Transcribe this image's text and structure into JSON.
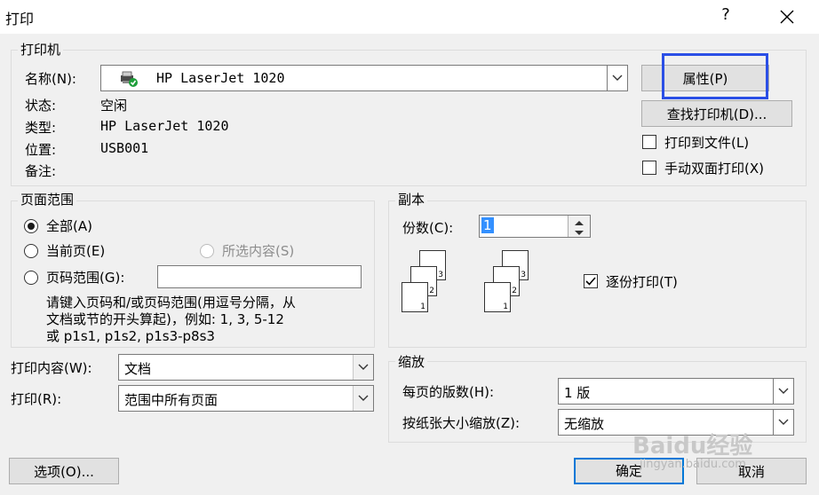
{
  "window": {
    "title": "打印",
    "help": "?"
  },
  "printer": {
    "group_label": "打印机",
    "name_label": "名称(N):",
    "name_value": "HP LaserJet 1020",
    "status_label": "状态:",
    "status_value": "空闲",
    "type_label": "类型:",
    "type_value": "HP LaserJet 1020",
    "where_label": "位置:",
    "where_value": "USB001",
    "comment_label": "备注:",
    "properties_button": "属性(P)",
    "find_button": "查找打印机(D)...",
    "print_to_file_label": "打印到文件(L)",
    "print_to_file_checked": false,
    "manual_duplex_label": "手动双面打印(X)",
    "manual_duplex_checked": false
  },
  "page_range": {
    "group_label": "页面范围",
    "all_label": "全部(A)",
    "current_label": "当前页(E)",
    "selection_label": "所选内容(S)",
    "pages_label": "页码范围(G):",
    "pages_value": "",
    "selected": "all",
    "hint_line1": "请键入页码和/或页码范围(用逗号分隔，从",
    "hint_line2": "文档或节的开头算起)，例如: 1, 3, 5-12",
    "hint_line3": "或 p1s1, p1s2, p1s3-p8s3"
  },
  "copies": {
    "group_label": "副本",
    "count_label": "份数(C):",
    "count_value": "1",
    "collate_label": "逐份打印(T)",
    "collate_checked": true,
    "page_numbers": [
      "1",
      "2",
      "3"
    ]
  },
  "print_what": {
    "label": "打印内容(W):",
    "value": "文档"
  },
  "print": {
    "label": "打印(R):",
    "value": "范围中所有页面"
  },
  "zoom": {
    "group_label": "缩放",
    "pages_per_sheet_label": "每页的版数(H):",
    "pages_per_sheet_value": "1 版",
    "scale_label": "按纸张大小缩放(Z):",
    "scale_value": "无缩放"
  },
  "footer": {
    "options_button": "选项(O)...",
    "ok_button": "确定",
    "cancel_button": "取消"
  },
  "watermark": {
    "text": "Baidu经验",
    "url": "jingyan.baidu.com"
  }
}
